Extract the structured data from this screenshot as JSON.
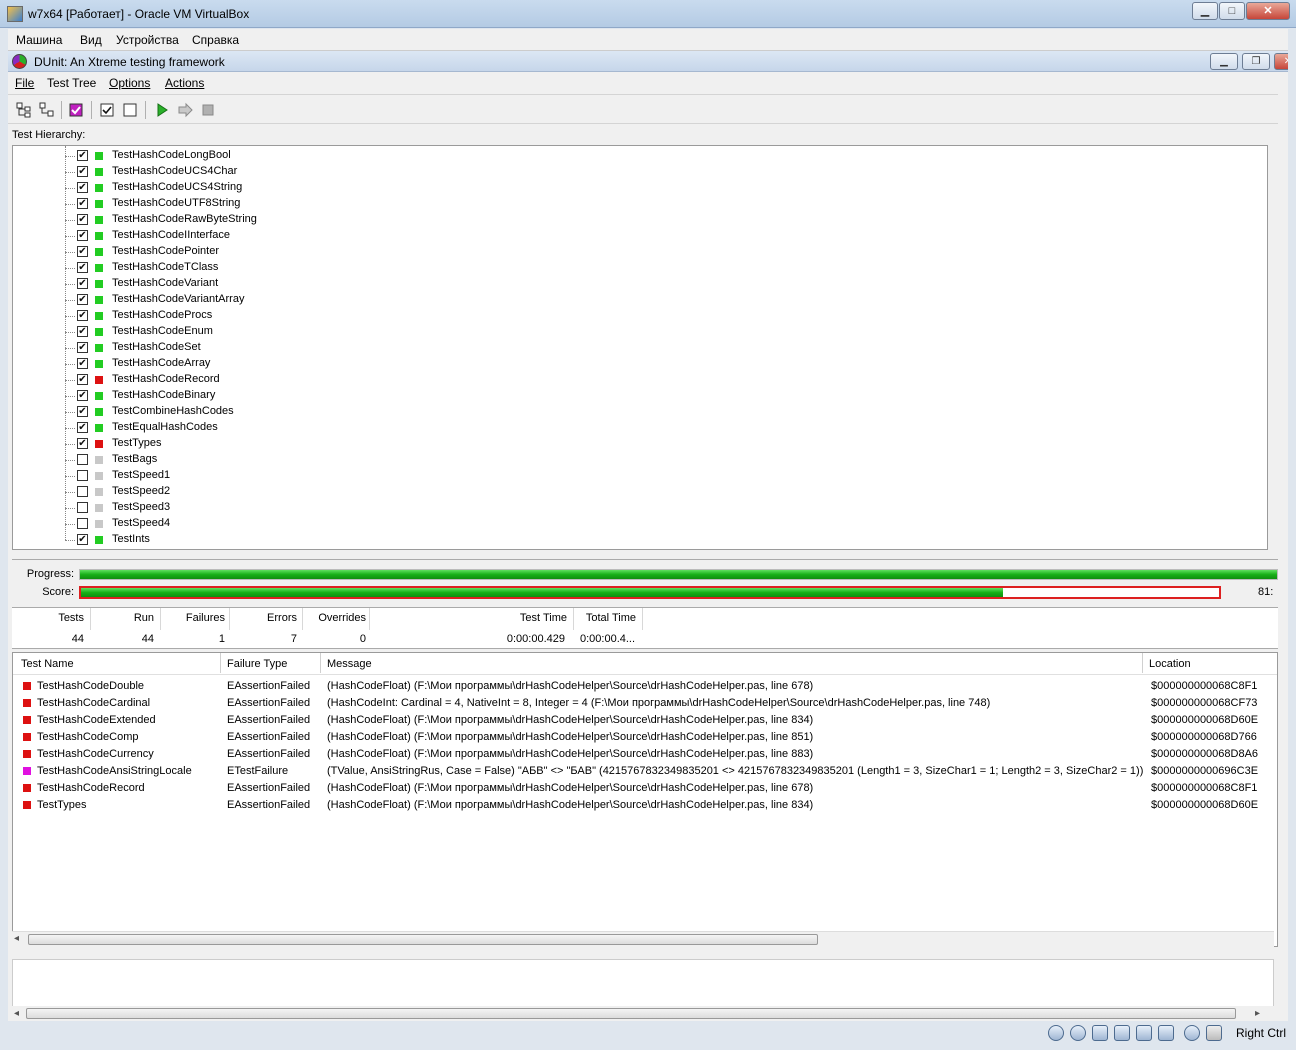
{
  "vbox": {
    "title": "w7x64 [Работает] - Oracle VM VirtualBox",
    "menu": [
      "Машина",
      "Вид",
      "Устройства",
      "Справка"
    ],
    "host_key": "Right Ctrl"
  },
  "dunit": {
    "title": "DUnit: An Xtreme testing framework",
    "menu": [
      {
        "label": "File",
        "mnemonic": "F"
      },
      {
        "label": "Test Tree",
        "mnemonic": "T"
      },
      {
        "label": "Options",
        "mnemonic": "O"
      },
      {
        "label": "Actions",
        "mnemonic": "A"
      }
    ],
    "hierarchy_label": "Test Hierarchy:",
    "tree": [
      {
        "name": "TestHashCodeLongBool",
        "checked": true,
        "status": "pass"
      },
      {
        "name": "TestHashCodeUCS4Char",
        "checked": true,
        "status": "pass"
      },
      {
        "name": "TestHashCodeUCS4String",
        "checked": true,
        "status": "pass"
      },
      {
        "name": "TestHashCodeUTF8String",
        "checked": true,
        "status": "pass"
      },
      {
        "name": "TestHashCodeRawByteString",
        "checked": true,
        "status": "pass"
      },
      {
        "name": "TestHashCodeIInterface",
        "checked": true,
        "status": "pass"
      },
      {
        "name": "TestHashCodePointer",
        "checked": true,
        "status": "pass"
      },
      {
        "name": "TestHashCodeTClass",
        "checked": true,
        "status": "pass"
      },
      {
        "name": "TestHashCodeVariant",
        "checked": true,
        "status": "pass"
      },
      {
        "name": "TestHashCodeVariantArray",
        "checked": true,
        "status": "pass"
      },
      {
        "name": "TestHashCodeProcs",
        "checked": true,
        "status": "pass"
      },
      {
        "name": "TestHashCodeEnum",
        "checked": true,
        "status": "pass"
      },
      {
        "name": "TestHashCodeSet",
        "checked": true,
        "status": "pass"
      },
      {
        "name": "TestHashCodeArray",
        "checked": true,
        "status": "pass"
      },
      {
        "name": "TestHashCodeRecord",
        "checked": true,
        "status": "fail"
      },
      {
        "name": "TestHashCodeBinary",
        "checked": true,
        "status": "pass"
      },
      {
        "name": "TestCombineHashCodes",
        "checked": true,
        "status": "pass"
      },
      {
        "name": "TestEqualHashCodes",
        "checked": true,
        "status": "pass"
      },
      {
        "name": "TestTypes",
        "checked": true,
        "status": "fail"
      },
      {
        "name": "TestBags",
        "checked": false,
        "status": "skip"
      },
      {
        "name": "TestSpeed1",
        "checked": false,
        "status": "skip"
      },
      {
        "name": "TestSpeed2",
        "checked": false,
        "status": "skip"
      },
      {
        "name": "TestSpeed3",
        "checked": false,
        "status": "skip"
      },
      {
        "name": "TestSpeed4",
        "checked": false,
        "status": "skip"
      },
      {
        "name": "TestInts",
        "checked": true,
        "status": "pass"
      }
    ],
    "progress": {
      "label": "Progress:",
      "fraction": 1.0
    },
    "score": {
      "label": "Score:",
      "fraction": 0.81,
      "value_text": "81:"
    },
    "stats": {
      "headers": [
        "Tests",
        "Run",
        "Failures",
        "Errors",
        "Overrides",
        "Test Time",
        "Total Time"
      ],
      "values": [
        "44",
        "44",
        "1",
        "7",
        "0",
        "0:00:00.429",
        "0:00:00.4..."
      ]
    },
    "failures": {
      "headers": [
        "Test Name",
        "Failure Type",
        "Message",
        "Location"
      ],
      "rows": [
        {
          "status": "error",
          "name": "TestHashCodeDouble",
          "type": "EAssertionFailed",
          "message": "(HashCodeFloat) (F:\\Мои программы\\drHashCodeHelper\\Source\\drHashCodeHelper.pas, line 678)",
          "location": "$000000000068C8F1"
        },
        {
          "status": "error",
          "name": "TestHashCodeCardinal",
          "type": "EAssertionFailed",
          "message": "(HashCodeInt: Cardinal = 4, NativeInt = 8, Integer = 4 (F:\\Мои программы\\drHashCodeHelper\\Source\\drHashCodeHelper.pas, line 748)",
          "location": "$000000000068CF73"
        },
        {
          "status": "error",
          "name": "TestHashCodeExtended",
          "type": "EAssertionFailed",
          "message": "(HashCodeFloat) (F:\\Мои программы\\drHashCodeHelper\\Source\\drHashCodeHelper.pas, line 834)",
          "location": "$000000000068D60E"
        },
        {
          "status": "error",
          "name": "TestHashCodeComp",
          "type": "EAssertionFailed",
          "message": "(HashCodeFloat) (F:\\Мои программы\\drHashCodeHelper\\Source\\drHashCodeHelper.pas, line 851)",
          "location": "$000000000068D766"
        },
        {
          "status": "error",
          "name": "TestHashCodeCurrency",
          "type": "EAssertionFailed",
          "message": "(HashCodeFloat) (F:\\Мои программы\\drHashCodeHelper\\Source\\drHashCodeHelper.pas, line 883)",
          "location": "$000000000068D8A6"
        },
        {
          "status": "failure",
          "name": "TestHashCodeAnsiStringLocale",
          "type": "ETestFailure",
          "message": "(TValue, AnsiStringRus, Case = False) \"АБВ\" <> \"БАВ\" (4215767832349835201 <> 4215767832349835201 (Length1 = 3, SizeChar1 = 1; Length2 = 3, SizeChar2 = 1))",
          "location": "$0000000000696C3E"
        },
        {
          "status": "error",
          "name": "TestHashCodeRecord",
          "type": "EAssertionFailed",
          "message": "(HashCodeFloat) (F:\\Мои программы\\drHashCodeHelper\\Source\\drHashCodeHelper.pas, line 678)",
          "location": "$000000000068C8F1"
        },
        {
          "status": "error",
          "name": "TestTypes",
          "type": "EAssertionFailed",
          "message": "(HashCodeFloat) (F:\\Мои программы\\drHashCodeHelper\\Source\\drHashCodeHelper.pas, line 834)",
          "location": "$000000000068D60E"
        }
      ]
    }
  },
  "colors": {
    "pass": "#22cc22",
    "fail": "#dd1111",
    "skip": "#c8c8c8",
    "error": "#dd1111",
    "failure": "#e010e0"
  }
}
